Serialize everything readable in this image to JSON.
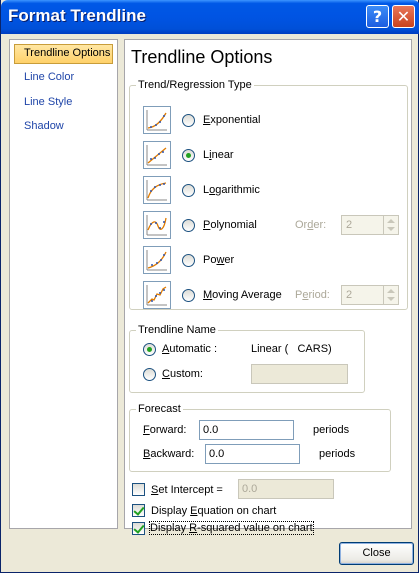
{
  "window": {
    "title": "Format Trendline"
  },
  "titlebar": {
    "help_label": "?",
    "close_label": "✕"
  },
  "sidebar": {
    "items": [
      {
        "label": "Trendline Options",
        "active": true
      },
      {
        "label": "Line Color",
        "active": false
      },
      {
        "label": "Line Style",
        "active": false
      },
      {
        "label": "Shadow",
        "active": false
      }
    ]
  },
  "panel": {
    "title": "Trendline Options",
    "regression": {
      "legend": "Trend/Regression Type",
      "types": [
        {
          "label": "Exponential",
          "underline": "E",
          "selected": false,
          "icon": "exponential-chart-icon"
        },
        {
          "label": "Linear",
          "underline": "i",
          "selected": true,
          "icon": "linear-chart-icon"
        },
        {
          "label": "Logarithmic",
          "underline": "o",
          "selected": false,
          "icon": "logarithmic-chart-icon"
        },
        {
          "label": "Polynomial",
          "underline": "P",
          "selected": false,
          "icon": "polynomial-chart-icon"
        },
        {
          "label": "Power",
          "underline": "w",
          "selected": false,
          "icon": "power-chart-icon"
        },
        {
          "label": "Moving Average",
          "underline": "M",
          "selected": false,
          "icon": "moving-average-chart-icon"
        }
      ],
      "order_label": "Order:",
      "order_value": "2",
      "period_label": "Period:",
      "period_value": "2"
    },
    "name_group": {
      "legend": "Trendline Name",
      "automatic_label": "Automatic :",
      "automatic_value": "Linear (   CARS)",
      "custom_label": "Custom:",
      "custom_value": ""
    },
    "forecast": {
      "legend": "Forecast",
      "forward_label": "Forward:",
      "forward_value": "0.0",
      "forward_unit": "periods",
      "backward_label": "Backward:",
      "backward_value": "0.0",
      "backward_unit": "periods"
    },
    "options": {
      "set_intercept_label": "Set Intercept =",
      "set_intercept_value": "0.0",
      "set_intercept_checked": false,
      "display_equation_label": "Display Equation on chart",
      "display_equation_checked": true,
      "display_rsquared_label": "Display R-squared value on chart",
      "display_rsquared_checked": true
    }
  },
  "footer": {
    "close_label": "Close"
  }
}
